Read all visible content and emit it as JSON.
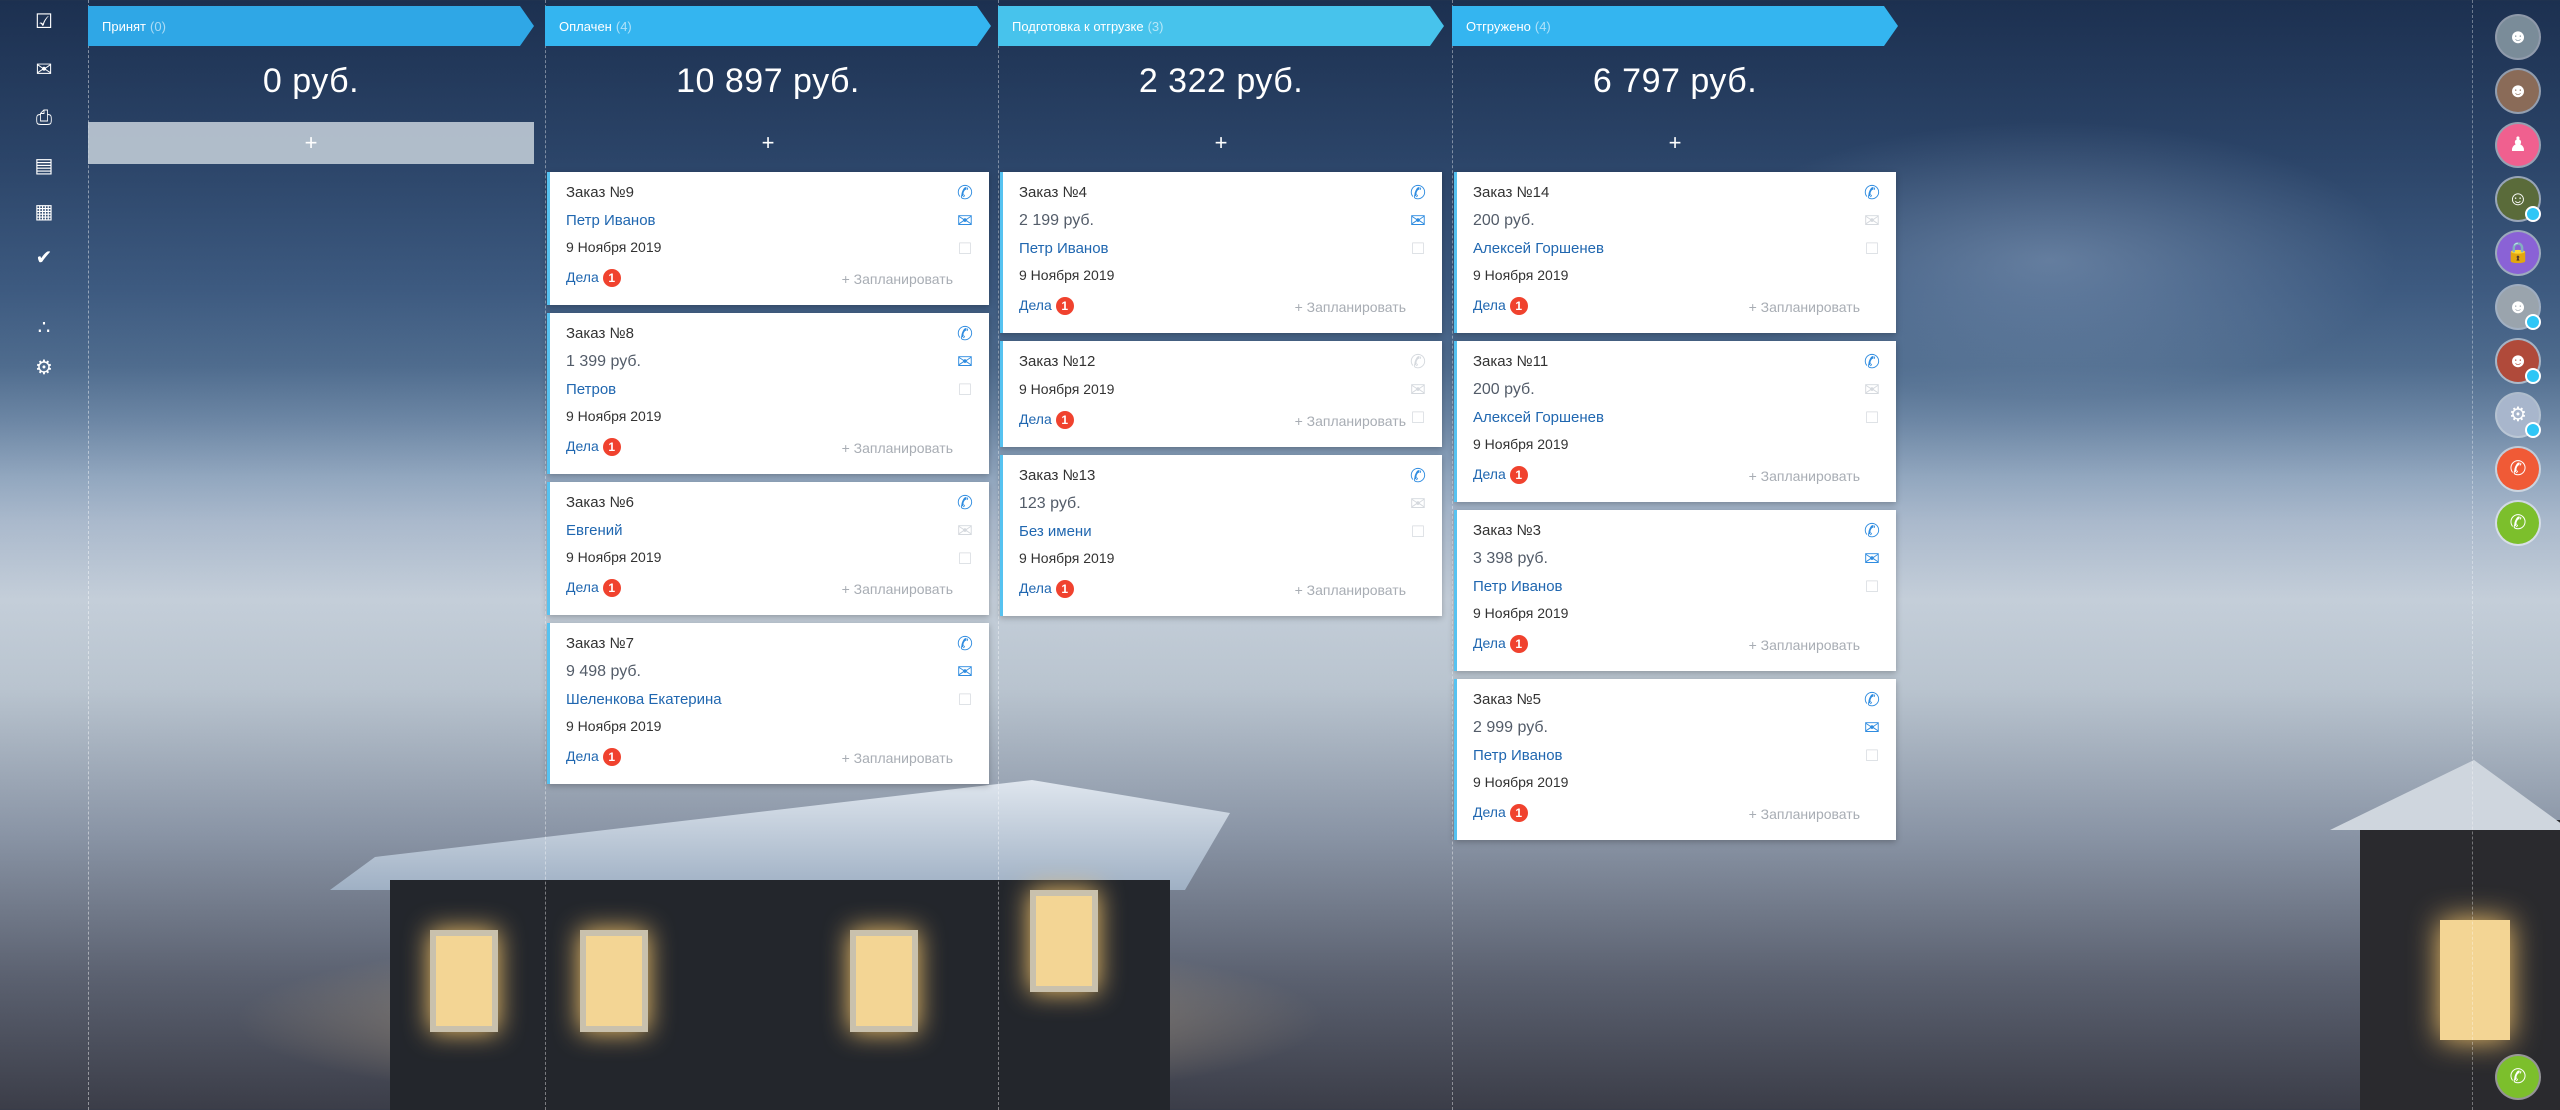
{
  "left_toolbar": {
    "icons": [
      "tasks-icon",
      "mail-icon",
      "printer-icon",
      "calendar-icon",
      "grid-icon",
      "check-circle-icon",
      "sitemap-icon",
      "settings-icon"
    ]
  },
  "columns": [
    {
      "title": "Принят",
      "count": "(0)",
      "color": "#2fa7e6",
      "sum": "0 руб.",
      "add": "+",
      "cards": []
    },
    {
      "title": "Оплачен",
      "count": "(4)",
      "color": "#34b5f0",
      "sum": "10 897 руб.",
      "add": "+",
      "cards": [
        {
          "title": "Заказ №9",
          "price": "",
          "client": "Петр Иванов",
          "date": "9 Ноября 2019",
          "deals": "Дела",
          "deals_count": "1",
          "plan": "+ Запланировать",
          "icons": [
            "phone",
            "mail",
            "chat"
          ]
        },
        {
          "title": "Заказ №8",
          "price": "1 399 руб.",
          "client": "Петров",
          "date": "9 Ноября 2019",
          "deals": "Дела",
          "deals_count": "1",
          "plan": "+ Запланировать",
          "icons": [
            "phone",
            "mail",
            "chat"
          ]
        },
        {
          "title": "Заказ №6",
          "price": "",
          "client": "Евгений",
          "date": "9 Ноября 2019",
          "deals": "Дела",
          "deals_count": "1",
          "plan": "+ Запланировать",
          "icons": [
            "phone",
            "mail-gray",
            "chat"
          ]
        },
        {
          "title": "Заказ №7",
          "price": "9 498 руб.",
          "client": "Шеленкова Екатерина",
          "date": "9 Ноября 2019",
          "deals": "Дела",
          "deals_count": "1",
          "plan": "+ Запланировать",
          "icons": [
            "phone",
            "mail",
            "chat"
          ]
        }
      ]
    },
    {
      "title": "Подготовка к отгрузке",
      "count": "(3)",
      "color": "#47c3ec",
      "sum": "2 322 руб.",
      "add": "+",
      "cards": [
        {
          "title": "Заказ №4",
          "price": "2 199 руб.",
          "client": "Петр Иванов",
          "date": "9 Ноября 2019",
          "deals": "Дела",
          "deals_count": "1",
          "plan": "+ Запланировать",
          "icons": [
            "phone",
            "mail",
            "chat"
          ]
        },
        {
          "title": "Заказ №12",
          "price": "",
          "client": "",
          "date": "9 Ноября 2019",
          "deals": "Дела",
          "deals_count": "1",
          "plan": "+ Запланировать",
          "icons": [
            "phone-gray",
            "mail-gray",
            "chat"
          ]
        },
        {
          "title": "Заказ №13",
          "price": "123 руб.",
          "client": "Без имени",
          "date": "9 Ноября 2019",
          "deals": "Дела",
          "deals_count": "1",
          "plan": "+ Запланировать",
          "icons": [
            "phone",
            "mail-gray",
            "chat"
          ]
        }
      ]
    },
    {
      "title": "Отгружено",
      "count": "(4)",
      "color": "#34b5f0",
      "sum": "6 797 руб.",
      "add": "+",
      "cards": [
        {
          "title": "Заказ №14",
          "price": "200 руб.",
          "client": "Алексей Горшенев",
          "date": "9 Ноября 2019",
          "deals": "Дела",
          "deals_count": "1",
          "plan": "+ Запланировать",
          "icons": [
            "phone",
            "mail-gray",
            "chat"
          ]
        },
        {
          "title": "Заказ №11",
          "price": "200 руб.",
          "client": "Алексей Горшенев",
          "date": "9 Ноября 2019",
          "deals": "Дела",
          "deals_count": "1",
          "plan": "+ Запланировать",
          "icons": [
            "phone",
            "mail-gray",
            "chat"
          ]
        },
        {
          "title": "Заказ №3",
          "price": "3 398 руб.",
          "client": "Петр Иванов",
          "date": "9 Ноября 2019",
          "deals": "Дела",
          "deals_count": "1",
          "plan": "+ Запланировать",
          "icons": [
            "phone",
            "mail",
            "chat"
          ]
        },
        {
          "title": "Заказ №5",
          "price": "2 999 руб.",
          "client": "Петр Иванов",
          "date": "9 Ноября 2019",
          "deals": "Дела",
          "deals_count": "1",
          "plan": "+ Запланировать",
          "icons": [
            "phone",
            "mail",
            "chat"
          ]
        }
      ]
    }
  ],
  "right_bar": {
    "avatars": [
      {
        "name": "user-avatar",
        "color": "#7a8c99"
      },
      {
        "name": "user-avatar",
        "color": "#8a6b58"
      },
      {
        "name": "user-avatar",
        "color": "#f0608f"
      },
      {
        "name": "group-chat-avatar",
        "color": "#5a6b3a"
      },
      {
        "name": "lock-chat-avatar",
        "color": "#8a62d6"
      },
      {
        "name": "user-avatar",
        "color": "#9aa4ad"
      },
      {
        "name": "user-avatar",
        "color": "#b04a3a"
      },
      {
        "name": "bot-avatar",
        "color": "#a8b6cc"
      },
      {
        "name": "missed-call-icon",
        "color": "#f05a36"
      },
      {
        "name": "call-icon",
        "color": "#7cbf2c"
      }
    ],
    "bottom_call_color": "#7cbf2c"
  }
}
